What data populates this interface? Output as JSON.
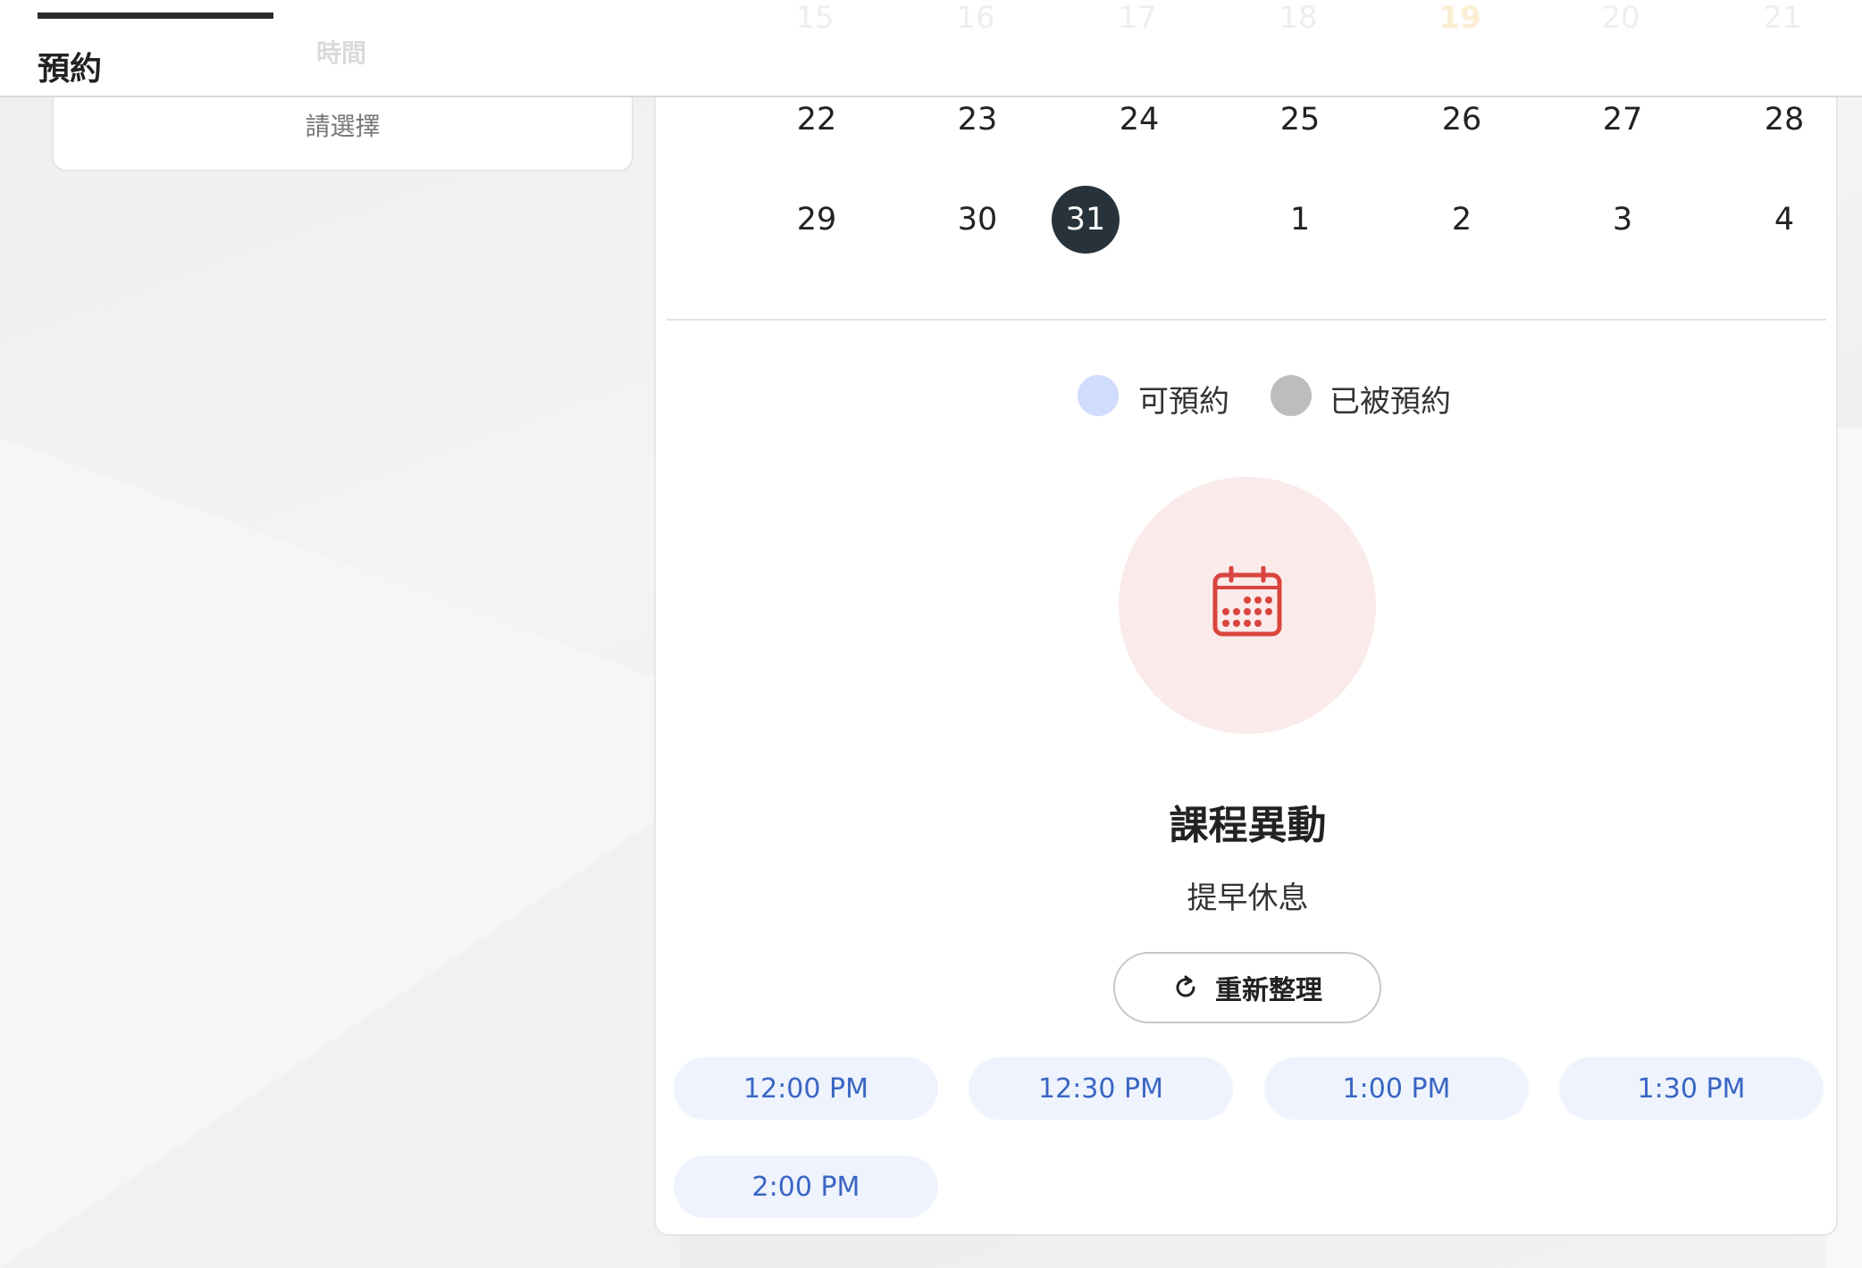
{
  "tabs": {
    "booking": "預約",
    "time": "時間"
  },
  "header_faded_days": [
    "15",
    "16",
    "17",
    "18",
    "19",
    "20",
    "21"
  ],
  "left_card": {
    "placeholder": "請選擇"
  },
  "calendar": {
    "week_1": [
      "22",
      "23",
      "24",
      "25",
      "26",
      "27",
      "28"
    ],
    "week_2": [
      "29",
      "30",
      "31",
      "1",
      "2",
      "3",
      "4"
    ],
    "selected_day": "31"
  },
  "legend": {
    "available": {
      "label": "可預約",
      "color": "#cfdcfb"
    },
    "booked": {
      "label": "已被預約",
      "color": "#bdbdbd"
    }
  },
  "notice": {
    "icon": "calendar-icon",
    "title": "課程異動",
    "description": "提早休息",
    "refresh_label": "重新整理"
  },
  "time_slots": [
    "12:00 PM",
    "12:30 PM",
    "1:00 PM",
    "1:30 PM",
    "2:00 PM"
  ],
  "colors": {
    "selected_day_bg": "#27323a",
    "slot_bg": "#eef3fd",
    "slot_text": "#3a66c4",
    "icon_red": "#d9453d",
    "icon_circle_bg": "#fbeaea"
  }
}
